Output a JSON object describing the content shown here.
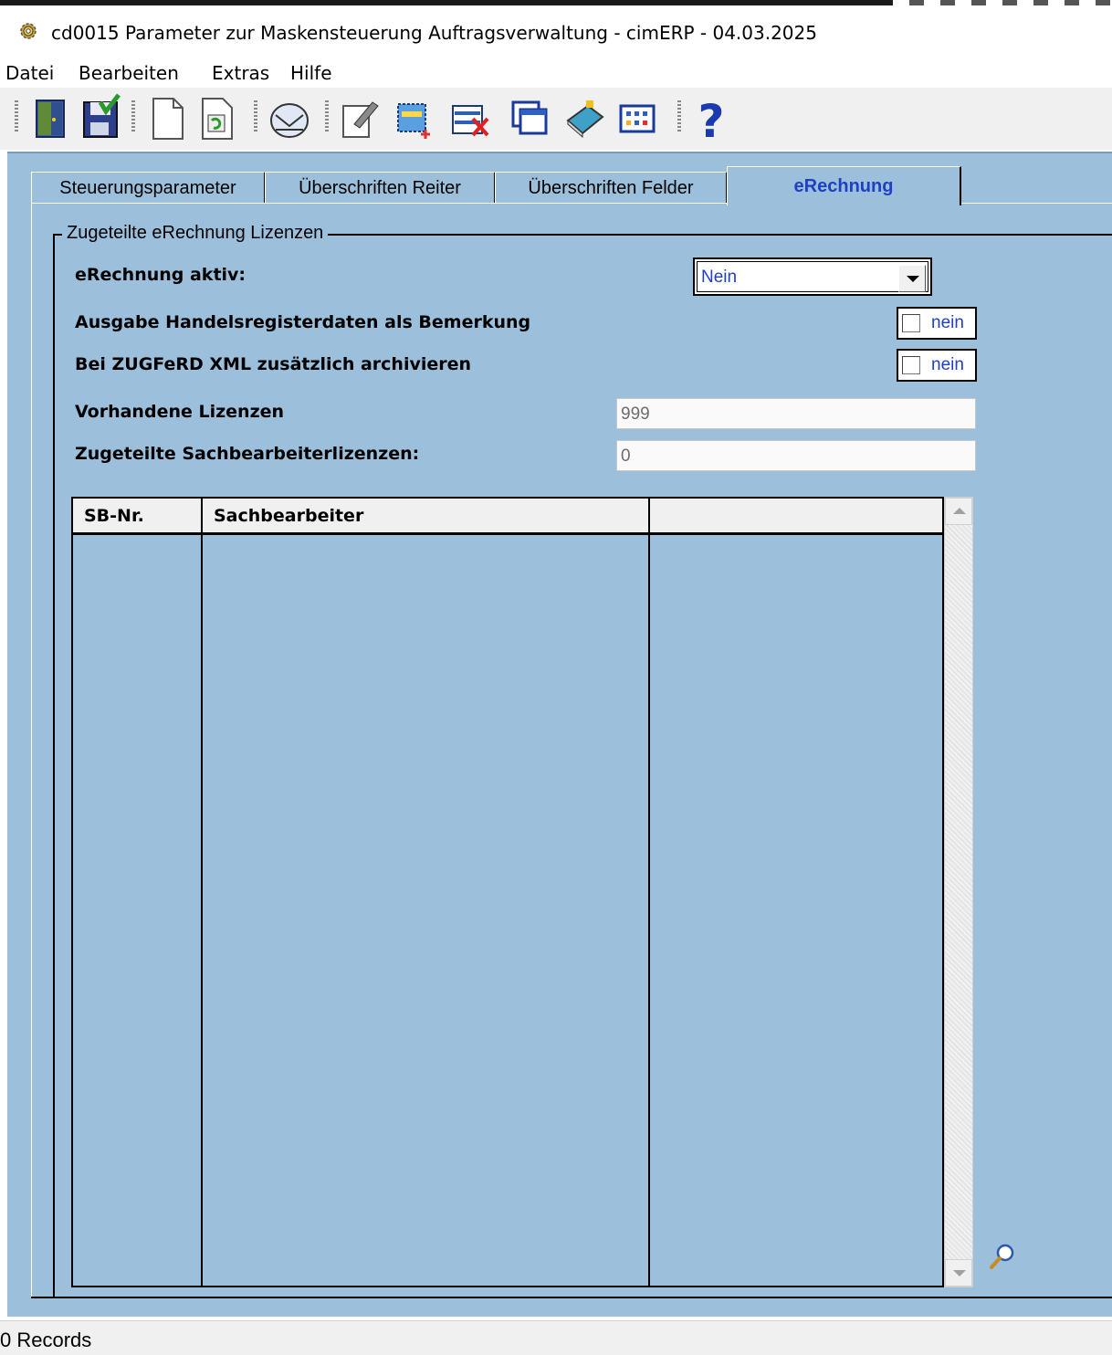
{
  "window": {
    "title": "cd0015 Parameter zur Maskensteuerung Auftragsverwaltung - cimERP - 04.03.2025"
  },
  "menu": {
    "items": [
      "Datei",
      "Bearbeiten",
      "Extras",
      "Hilfe"
    ]
  },
  "toolbar": {
    "icons": [
      "exit-door-icon",
      "save-icon",
      "new-document-icon",
      "refresh-document-icon",
      "mail-icon",
      "edit-form-icon",
      "add-record-icon",
      "delete-record-icon",
      "windows-icon",
      "book-icon",
      "table-icon",
      "help-icon"
    ]
  },
  "tabs": [
    {
      "label": "Steuerungsparameter",
      "active": false
    },
    {
      "label": "Überschriften Reiter",
      "active": false
    },
    {
      "label": "Überschriften Felder",
      "active": false
    },
    {
      "label": "eRechnung",
      "active": true
    }
  ],
  "group": {
    "legend": "Zugeteilte eRechnung Lizenzen"
  },
  "form": {
    "erechnung_aktiv_label": "eRechnung aktiv:",
    "erechnung_aktiv_value": "Nein",
    "handelsregister_label": "Ausgabe Handelsregisterdaten als Bemerkung",
    "handelsregister_value": "nein",
    "zugferd_label": "Bei ZUGFeRD XML zusätzlich archivieren",
    "zugferd_value": "nein",
    "lizenzen_label": "Vorhandene Lizenzen",
    "lizenzen_value": "999",
    "sb_lizenzen_label": "Zugeteilte Sachbearbeiterlizenzen:",
    "sb_lizenzen_value": "0"
  },
  "grid": {
    "columns": [
      "SB-Nr.",
      "Sachbearbeiter",
      ""
    ],
    "rows": []
  },
  "status": {
    "text": "0 Records"
  },
  "colors": {
    "panel_bg": "#9cc0dc",
    "accent_blue": "#1f3fc4"
  }
}
